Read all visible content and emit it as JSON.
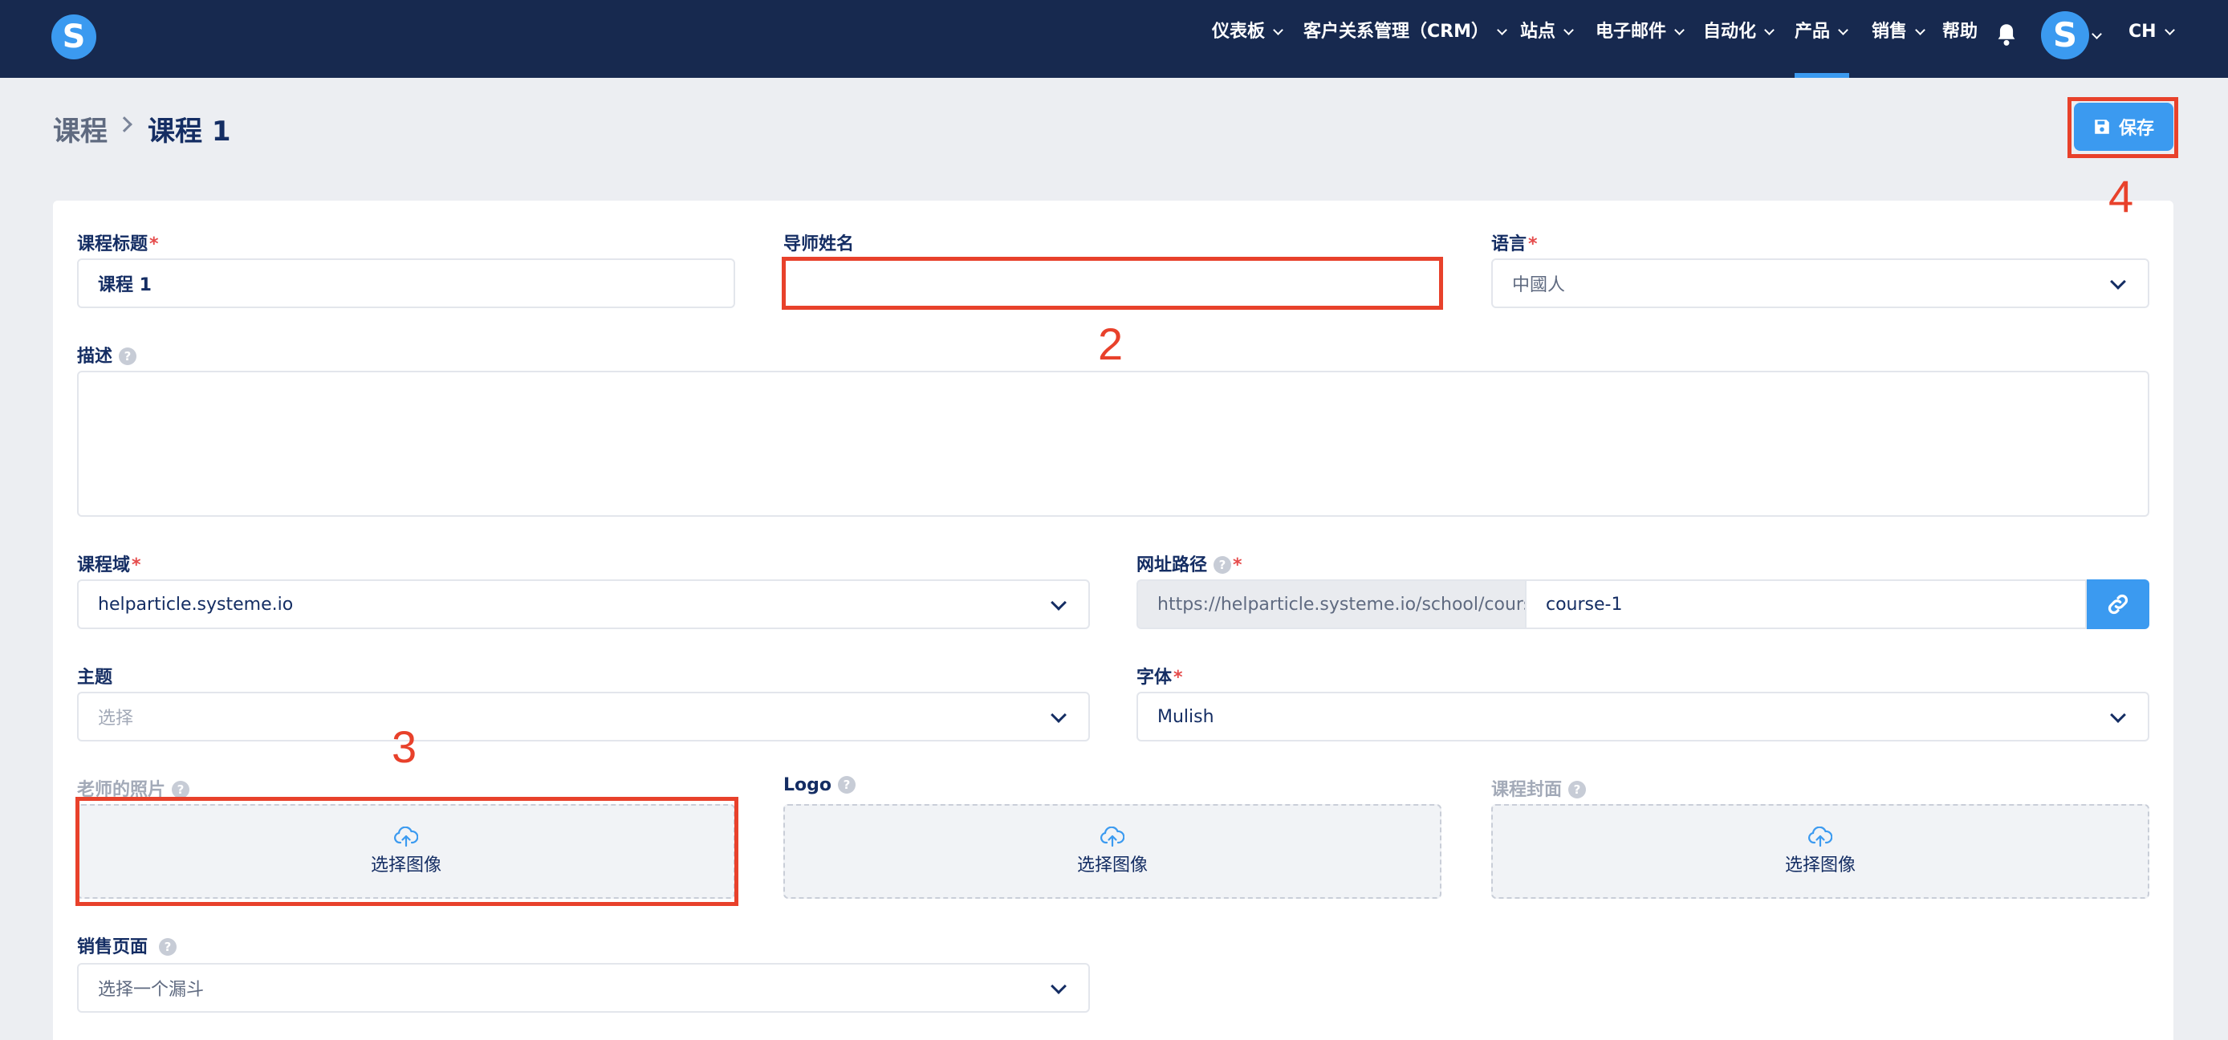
{
  "topbar": {
    "logo_letter": "S",
    "nav": [
      {
        "label": "仪表板"
      },
      {
        "label": "客户关系管理（CRM）"
      },
      {
        "label": "站点"
      },
      {
        "label": "电子邮件"
      },
      {
        "label": "自动化"
      },
      {
        "label": "产品",
        "active": true
      },
      {
        "label": "销售"
      },
      {
        "label": "帮助"
      }
    ],
    "avatar_letter": "S",
    "language": "CH"
  },
  "breadcrumb": {
    "parent": "课程",
    "current": "课程 1"
  },
  "save_button": {
    "label": "保存"
  },
  "form": {
    "course_title": {
      "label": "课程标题",
      "value": "课程 1"
    },
    "instructor_name": {
      "label": "导师姓名",
      "value": ""
    },
    "language": {
      "label": "语言",
      "value": "中國人"
    },
    "description": {
      "label": "描述",
      "value": ""
    },
    "course_domain": {
      "label": "课程域",
      "value": "helparticle.systeme.io"
    },
    "url_path": {
      "label": "网址路径",
      "prefix": "https://helparticle.systeme.io/school/course/",
      "slug": "course-1"
    },
    "theme": {
      "label": "主题",
      "placeholder": "选择"
    },
    "font": {
      "label": "字体",
      "value": "Mulish"
    },
    "teacher_photo": {
      "label": "老师的照片",
      "button": "选择图像"
    },
    "logo": {
      "label": "Logo",
      "button": "选择图像"
    },
    "course_cover": {
      "label": "课程封面",
      "button": "选择图像"
    },
    "sales_page": {
      "label": "销售页面",
      "placeholder": "选择一个漏斗"
    }
  },
  "annotations": [
    "2",
    "3",
    "4"
  ],
  "colors": {
    "accent": "#3b9af0",
    "annotation": "#e8412b",
    "topbar": "#17294f"
  }
}
